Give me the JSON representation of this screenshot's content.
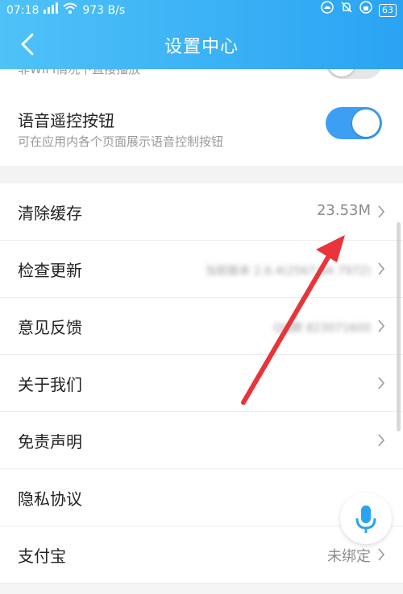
{
  "status": {
    "time": "07:18",
    "speed": "973 B/s",
    "battery": "63"
  },
  "header": {
    "title": "设置中心"
  },
  "toggles": [
    {
      "label": "",
      "sub": "非WIFI情况下直接播放",
      "state": "off"
    },
    {
      "label": "语音遥控按钮",
      "sub": "可在应用内各个页面展示语音控制按钮",
      "state": "on"
    }
  ],
  "list": [
    {
      "label": "清除缓存",
      "value": "23.53M",
      "chevron": true
    },
    {
      "label": "检查更新",
      "value": "当前版本 2.6.4(2567 0A 7972)",
      "chevron": true,
      "blurred": true
    },
    {
      "label": "意见反馈",
      "value": "QQ群 823071600",
      "chevron": true,
      "blurred": true
    },
    {
      "label": "关于我们",
      "value": "",
      "chevron": true
    },
    {
      "label": "免责声明",
      "value": "",
      "chevron": true
    },
    {
      "label": "隐私协议",
      "value": "",
      "chevron": false
    },
    {
      "label": "支付宝",
      "value": "未绑定",
      "chevron": true
    }
  ],
  "colors": {
    "accent": "#2aa3f3",
    "toggle_on": "#3c9ff3",
    "arrow": "#e8343a"
  },
  "icons": {
    "back": "chevron-left-icon",
    "mic": "microphone-icon"
  }
}
